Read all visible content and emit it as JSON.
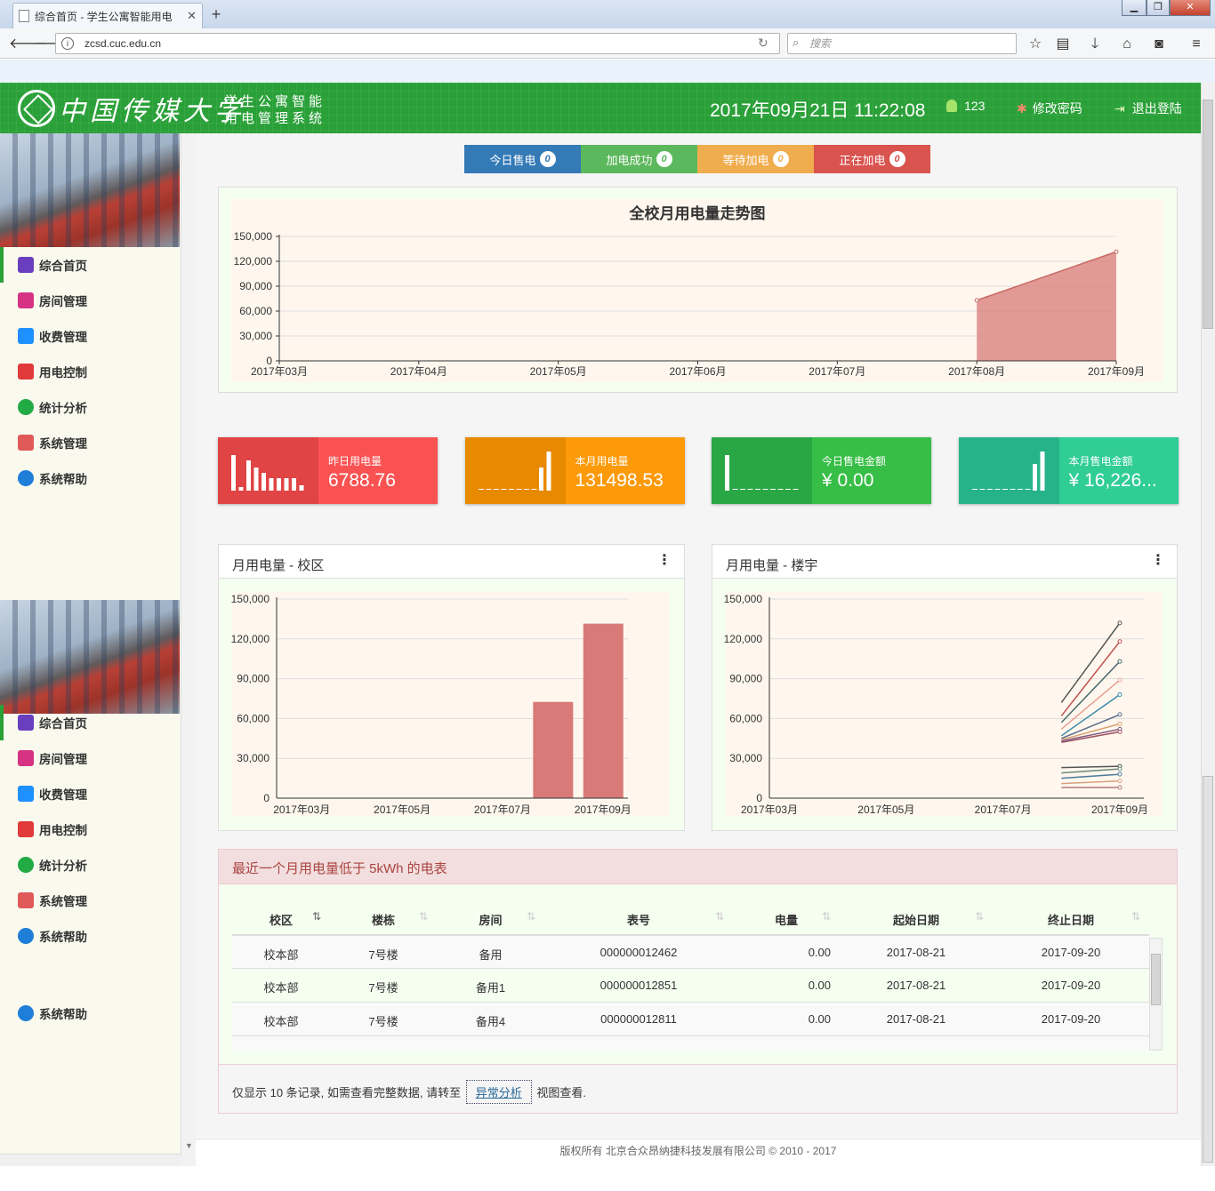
{
  "browser": {
    "tab_title": "综合首页 - 学生公寓智能用电",
    "url": "zcsd.cuc.edu.cn",
    "search_placeholder": "搜索"
  },
  "header": {
    "school": "中国传媒大学",
    "system_line1": "学生公寓智能",
    "system_line2": "用电管理系统",
    "datetime": "2017年09月21日 11:22:08",
    "user": "123",
    "change_password": "修改密码",
    "logout": "退出登陆"
  },
  "sidebar": {
    "menu": [
      {
        "label": "综合首页",
        "icon": "dashboard-icon",
        "color": "#6a3fbf"
      },
      {
        "label": "房间管理",
        "icon": "building-icon",
        "color": "#d63384"
      },
      {
        "label": "收费管理",
        "icon": "dollar-icon",
        "color": "#1e90ff"
      },
      {
        "label": "用电控制",
        "icon": "plug-icon",
        "color": "#e03a3a"
      },
      {
        "label": "统计分析",
        "icon": "pie-chart-icon",
        "color": "#22aa44"
      },
      {
        "label": "系统管理",
        "icon": "gears-icon",
        "color": "#e05a5a"
      },
      {
        "label": "系统帮助",
        "icon": "help-icon",
        "color": "#1e7ed8"
      }
    ],
    "extra_help": "系统帮助"
  },
  "status_buttons": [
    {
      "label": "今日售电",
      "count": "0",
      "color": "#337ab7",
      "count_color": "#337ab7"
    },
    {
      "label": "加电成功",
      "count": "0",
      "color": "#5cb85c",
      "count_color": "#5cb85c"
    },
    {
      "label": "等待加电",
      "count": "0",
      "color": "#f0ad4e",
      "count_color": "#f0ad4e"
    },
    {
      "label": "正在加电",
      "count": "0",
      "color": "#d9534f",
      "count_color": "#d9534f"
    }
  ],
  "stats": [
    {
      "label": "昨日用电量",
      "value": "6788.76",
      "dark": "#e04444",
      "light": "#fa5252"
    },
    {
      "label": "本月用电量",
      "value": "131498.53",
      "dark": "#e88a00",
      "light": "#fd9a0a"
    },
    {
      "label": "今日售电金额",
      "value": "¥ 0.00",
      "dark": "#2aa745",
      "light": "#37be46"
    },
    {
      "label": "本月售电金额",
      "value": "¥ 16,226...",
      "dark": "#26b38a",
      "light": "#30cd96"
    }
  ],
  "chart_data": [
    {
      "type": "area",
      "title": "全校月用电量走势图",
      "categories": [
        "2017年03月",
        "2017年04月",
        "2017年05月",
        "2017年06月",
        "2017年07月",
        "2017年08月",
        "2017年09月"
      ],
      "values": [
        null,
        null,
        null,
        null,
        null,
        73000,
        131500
      ],
      "yticks": [
        "0",
        "30,000",
        "60,000",
        "90,000",
        "120,000",
        "150,000"
      ],
      "ylim": [
        0,
        150000
      ],
      "color": "#d9827e",
      "grid": true
    },
    {
      "type": "bar",
      "title": "月用电量 - 校区",
      "categories": [
        "2017年03月",
        "2017年05月",
        "2017年07月",
        "2017年09月"
      ],
      "bars": [
        {
          "x": "2017年08月",
          "value": 72500
        },
        {
          "x": "2017年09月",
          "value": 131500
        }
      ],
      "yticks": [
        "0",
        "30,000",
        "60,000",
        "90,000",
        "120,000",
        "150,000"
      ],
      "ylim": [
        0,
        150000
      ],
      "color": "#d87a78"
    },
    {
      "type": "line",
      "title": "月用电量 - 楼宇",
      "categories": [
        "2017年03月",
        "2017年05月",
        "2017年07月",
        "2017年09月"
      ],
      "yticks": [
        "0",
        "30,000",
        "60,000",
        "90,000",
        "120,000",
        "150,000"
      ],
      "ylim": [
        0,
        150000
      ],
      "series": [
        {
          "values": [
            72000,
            132000
          ],
          "color": "#555"
        },
        {
          "values": [
            62000,
            118000
          ],
          "color": "#c0504d"
        },
        {
          "values": [
            57000,
            103000
          ],
          "color": "#4a6a6a"
        },
        {
          "values": [
            52000,
            89000
          ],
          "color": "#e8a090"
        },
        {
          "values": [
            47000,
            78000
          ],
          "color": "#3a8aa8"
        },
        {
          "values": [
            45000,
            63000
          ],
          "color": "#5a6a8a"
        },
        {
          "values": [
            44000,
            56000
          ],
          "color": "#d8a070"
        },
        {
          "values": [
            43000,
            52000
          ],
          "color": "#806080"
        },
        {
          "values": [
            42000,
            50000
          ],
          "color": "#a05060"
        },
        {
          "values": [
            23000,
            24000
          ],
          "color": "#555"
        },
        {
          "values": [
            19000,
            22000
          ],
          "color": "#6a8a7a"
        },
        {
          "values": [
            15000,
            18000
          ],
          "color": "#4a7a9a"
        },
        {
          "values": [
            11000,
            13000
          ],
          "color": "#d8a080"
        },
        {
          "values": [
            8000,
            8000
          ],
          "color": "#b07a7a"
        }
      ]
    }
  ],
  "panels": {
    "campus_title": "月用电量 - 校区",
    "building_title": "月用电量 - 楼宇",
    "low_title": "最近一个月用电量低于 5kWh 的电表",
    "footer_note_1": "仅显示 10 条记录, 如需查看完整数据, 请转至",
    "footer_link": "异常分析",
    "footer_note_2": "视图查看."
  },
  "table": {
    "headers": [
      "校区",
      "楼栋",
      "房间",
      "表号",
      "电量",
      "起始日期",
      "终止日期"
    ],
    "rows": [
      [
        "校本部",
        "7号楼",
        "备用",
        "000000012462",
        "0.00",
        "2017-08-21",
        "2017-09-20"
      ],
      [
        "校本部",
        "7号楼",
        "备用1",
        "000000012851",
        "0.00",
        "2017-08-21",
        "2017-09-20"
      ],
      [
        "校本部",
        "7号楼",
        "备用4",
        "000000012811",
        "0.00",
        "2017-08-21",
        "2017-09-20"
      ]
    ]
  },
  "footer": "版权所有 北京合众昂纳捷科技发展有限公司 © 2010 - 2017"
}
